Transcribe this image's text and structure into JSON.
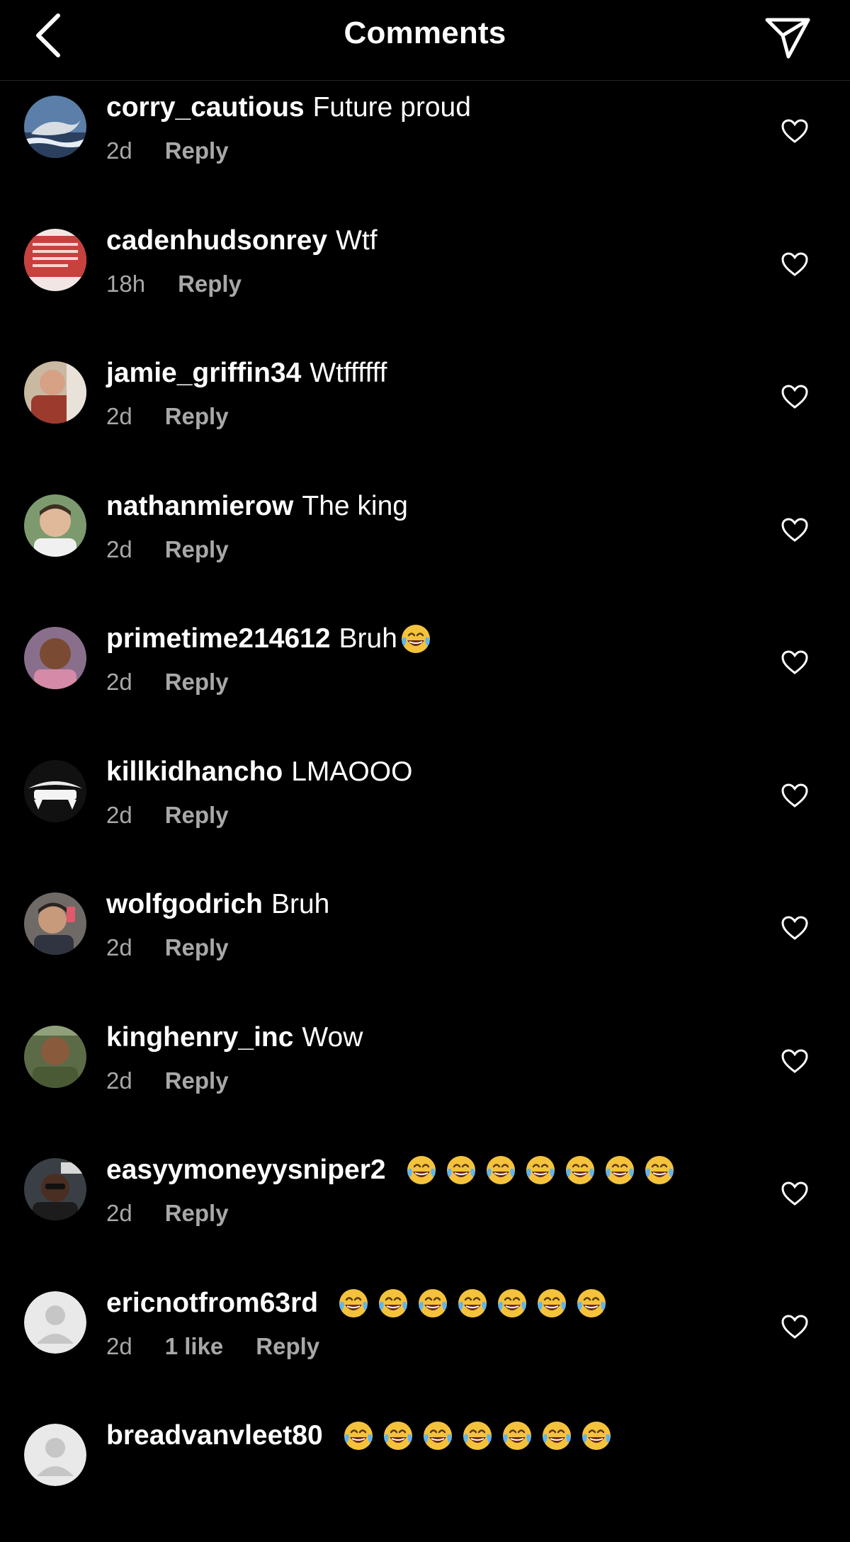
{
  "header": {
    "title": "Comments",
    "back_icon": "chevron-left-icon",
    "send_icon": "paper-plane-icon"
  },
  "comments": [
    {
      "username": "corry_cautious",
      "text": "Future proud",
      "emoji_count": 0,
      "time": "2d",
      "likes": "",
      "reply": "Reply"
    },
    {
      "username": "cadenhudsonrey",
      "text": "Wtf",
      "emoji_count": 0,
      "time": "18h",
      "likes": "",
      "reply": "Reply"
    },
    {
      "username": "jamie_griffin34",
      "text": "Wtffffff",
      "emoji_count": 0,
      "time": "2d",
      "likes": "",
      "reply": "Reply"
    },
    {
      "username": "nathanmierow",
      "text": "The king",
      "emoji_count": 0,
      "time": "2d",
      "likes": "",
      "reply": "Reply"
    },
    {
      "username": "primetime214612",
      "text": "Bruh",
      "emoji_count": 1,
      "time": "2d",
      "likes": "",
      "reply": "Reply"
    },
    {
      "username": "killkidhancho",
      "text": "LMAOOO",
      "emoji_count": 0,
      "time": "2d",
      "likes": "",
      "reply": "Reply"
    },
    {
      "username": "wolfgodrich",
      "text": "Bruh",
      "emoji_count": 0,
      "time": "2d",
      "likes": "",
      "reply": "Reply"
    },
    {
      "username": "kinghenry_inc",
      "text": "Wow",
      "emoji_count": 0,
      "time": "2d",
      "likes": "",
      "reply": "Reply"
    },
    {
      "username": "easyymoneyysniper2",
      "text": "",
      "emoji_count": 7,
      "time": "2d",
      "likes": "",
      "reply": "Reply"
    },
    {
      "username": "ericnotfrom63rd",
      "text": "",
      "emoji_count": 7,
      "time": "2d",
      "likes": "1 like",
      "reply": "Reply"
    },
    {
      "username": "breadvanvleet80",
      "text": "",
      "emoji_count": 7,
      "time": "",
      "likes": "",
      "reply": ""
    }
  ],
  "icons": {
    "emoji": "face-with-tears-of-joy-icon",
    "like": "heart-outline-icon"
  },
  "colors": {
    "background": "#000000",
    "text": "#ffffff",
    "secondary_text": "#a8a8a8",
    "divider": "#262626",
    "emoji_face": "#f5c33b"
  }
}
